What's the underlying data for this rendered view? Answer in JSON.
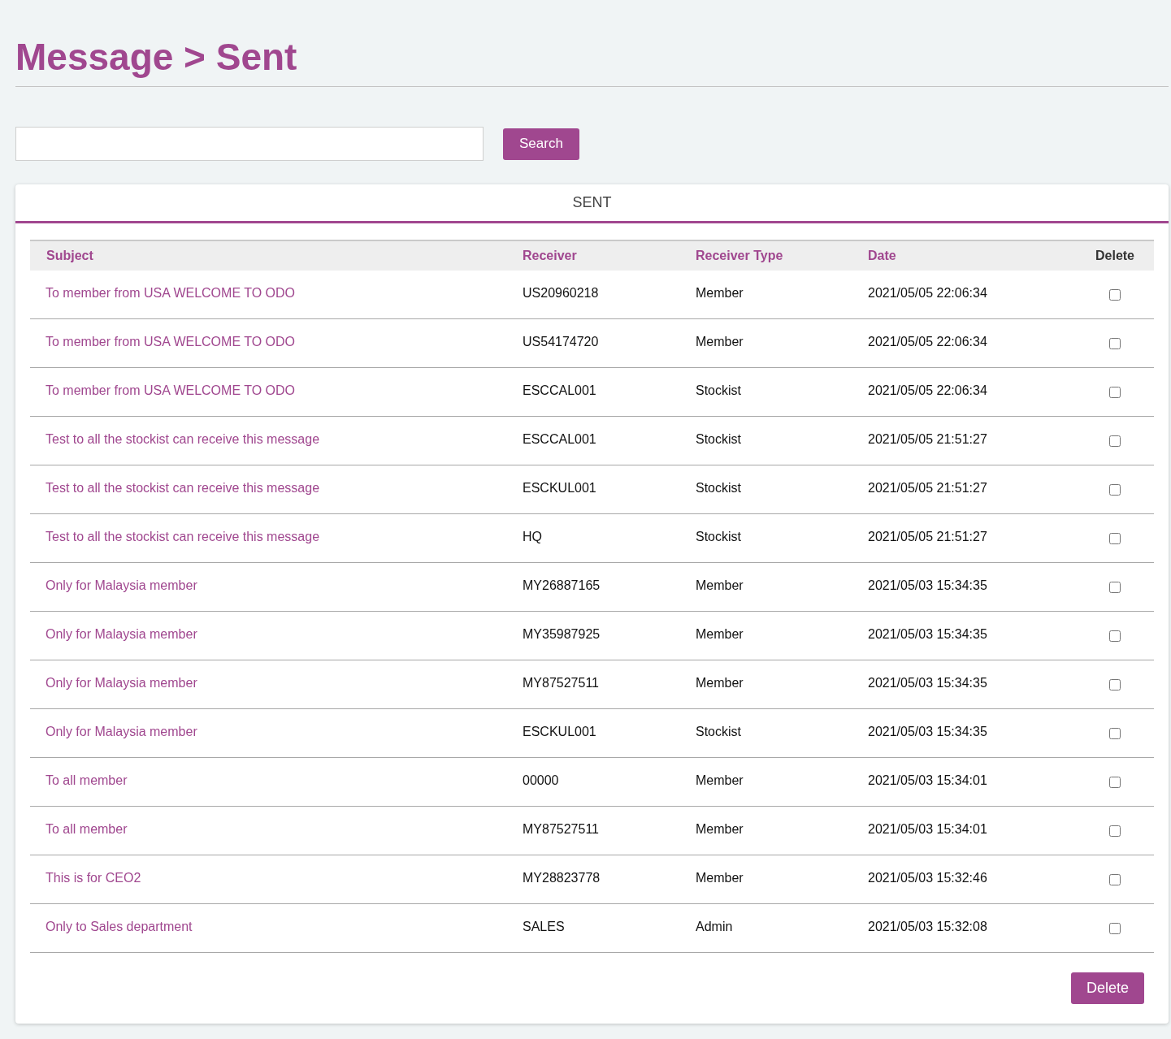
{
  "page_title": "Message > Sent",
  "search": {
    "button": "Search"
  },
  "panel": {
    "title": "SENT"
  },
  "table": {
    "columns": [
      {
        "label": "Subject",
        "sortable": true
      },
      {
        "label": "Receiver",
        "sortable": true
      },
      {
        "label": "Receiver Type",
        "sortable": true
      },
      {
        "label": "Date",
        "sortable": true
      },
      {
        "label": "Delete",
        "sortable": false
      }
    ],
    "rows": [
      {
        "subject": "To member from USA WELCOME TO ODO",
        "receiver": "US20960218",
        "receiver_type": "Member",
        "date": "2021/05/05 22:06:34",
        "checked": false
      },
      {
        "subject": "To member from USA WELCOME TO ODO",
        "receiver": "US54174720",
        "receiver_type": "Member",
        "date": "2021/05/05 22:06:34",
        "checked": false
      },
      {
        "subject": "To member from USA WELCOME TO ODO",
        "receiver": "ESCCAL001",
        "receiver_type": "Stockist",
        "date": "2021/05/05 22:06:34",
        "checked": false
      },
      {
        "subject": "Test to all the stockist can receive this message",
        "receiver": "ESCCAL001",
        "receiver_type": "Stockist",
        "date": "2021/05/05 21:51:27",
        "checked": false
      },
      {
        "subject": "Test to all the stockist can receive this message",
        "receiver": "ESCKUL001",
        "receiver_type": "Stockist",
        "date": "2021/05/05 21:51:27",
        "checked": false
      },
      {
        "subject": "Test to all the stockist can receive this message",
        "receiver": "HQ",
        "receiver_type": "Stockist",
        "date": "2021/05/05 21:51:27",
        "checked": false
      },
      {
        "subject": "Only for Malaysia member",
        "receiver": "MY26887165",
        "receiver_type": "Member",
        "date": "2021/05/03 15:34:35",
        "checked": false
      },
      {
        "subject": "Only for Malaysia member",
        "receiver": "MY35987925",
        "receiver_type": "Member",
        "date": "2021/05/03 15:34:35",
        "checked": false
      },
      {
        "subject": "Only for Malaysia member",
        "receiver": "MY87527511",
        "receiver_type": "Member",
        "date": "2021/05/03 15:34:35",
        "checked": false
      },
      {
        "subject": "Only for Malaysia member",
        "receiver": "ESCKUL001",
        "receiver_type": "Stockist",
        "date": "2021/05/03 15:34:35",
        "checked": false
      },
      {
        "subject": "To all member",
        "receiver": "00000",
        "receiver_type": "Member",
        "date": "2021/05/03 15:34:01",
        "checked": false
      },
      {
        "subject": "To all member",
        "receiver": "MY87527511",
        "receiver_type": "Member",
        "date": "2021/05/03 15:34:01",
        "checked": false
      },
      {
        "subject": "This is for CEO2",
        "receiver": "MY28823778",
        "receiver_type": "Member",
        "date": "2021/05/03 15:32:46",
        "checked": false
      },
      {
        "subject": "Only to Sales department",
        "receiver": "SALES",
        "receiver_type": "Admin",
        "date": "2021/05/03 15:32:08",
        "checked": false
      }
    ]
  },
  "delete_button": "Delete"
}
